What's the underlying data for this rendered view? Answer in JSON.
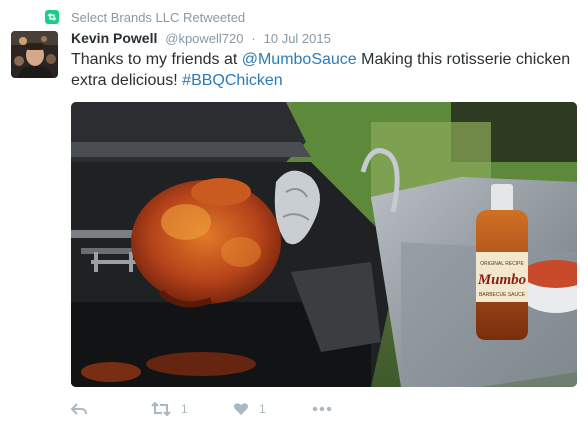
{
  "retweet": {
    "label": "Select Brands LLC Retweeted"
  },
  "author": {
    "name": "Kevin Powell",
    "handle": "@kpowell720",
    "separator": "·",
    "date": "10 Jul 2015"
  },
  "tweet": {
    "text_before": "Thanks to my friends at ",
    "mention": "@MumboSauce",
    "text_middle": " Making this rotisserie chicken extra delicious! ",
    "hashtag": "#BBQChicken"
  },
  "photo": {
    "bottle_brand": "Mumbo",
    "bottle_small_text": "ORIGINAL RECIPE",
    "bottle_bottom_text": "BARBECUE SAUCE"
  },
  "actions": {
    "reply_icon": "reply-icon",
    "retweet_count": "1",
    "like_count": "1",
    "more_icon": "more-icon"
  },
  "colors": {
    "link": "#2b7bb9",
    "muted": "#8899a6",
    "retweet_green": "#19cf86",
    "action_gray": "#aab8c2"
  }
}
